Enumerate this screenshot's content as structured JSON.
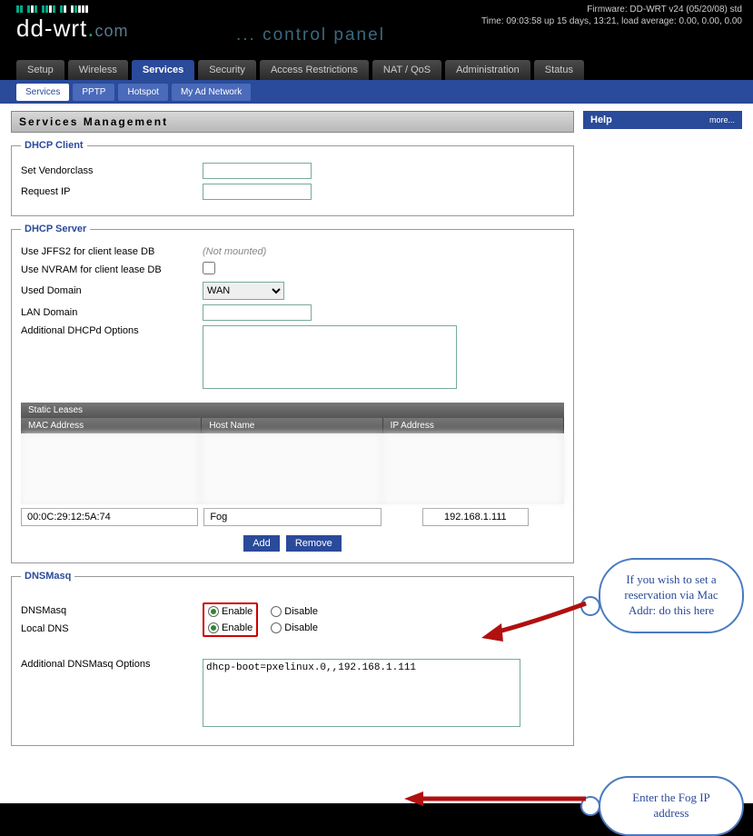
{
  "header": {
    "firmware": "Firmware: DD-WRT v24 (05/20/08) std",
    "time": "Time: 09:03:58 up 15 days, 13:21, load average: 0.00, 0.00, 0.00",
    "logo": "dd-wrt",
    "logo_dot": ".",
    "logo_com": "com",
    "cp": "... control panel"
  },
  "tabs": [
    "Setup",
    "Wireless",
    "Services",
    "Security",
    "Access Restrictions",
    "NAT / QoS",
    "Administration",
    "Status"
  ],
  "active_tab": "Services",
  "subtabs": [
    "Services",
    "PPTP",
    "Hotspot",
    "My Ad Network"
  ],
  "active_subtab": "Services",
  "title": "Services Management",
  "help": {
    "title": "Help",
    "more": "more..."
  },
  "dhcp_client": {
    "legend": "DHCP Client",
    "vendorclass_label": "Set Vendorclass",
    "vendorclass_value": "",
    "requestip_label": "Request IP",
    "requestip_value": ""
  },
  "dhcp_server": {
    "legend": "DHCP Server",
    "jffs2_label": "Use JFFS2 for client lease DB",
    "jffs2_status": "(Not mounted)",
    "nvram_label": "Use NVRAM for client lease DB",
    "used_domain_label": "Used Domain",
    "used_domain_value": "WAN",
    "lan_domain_label": "LAN Domain",
    "lan_domain_value": "",
    "dhcpd_options_label": "Additional DHCPd Options",
    "dhcpd_options_value": "",
    "static_leases": {
      "title": "Static Leases",
      "cols": [
        "MAC Address",
        "Host Name",
        "IP Address"
      ],
      "entry": {
        "mac": "00:0C:29:12:5A:74",
        "host": "Fog",
        "ip": "192.168.1.111"
      },
      "add": "Add",
      "remove": "Remove"
    }
  },
  "dnsmasq": {
    "legend": "DNSMasq",
    "dnsmasq_label": "DNSMasq",
    "localdns_label": "Local DNS",
    "enable": "Enable",
    "disable": "Disable",
    "options_label": "Additional DNSMasq Options",
    "options_value": "dhcp-boot=pxelinux.0,,192.168.1.111"
  },
  "callouts": {
    "c1": "If you wish to set a reservation via Mac Addr: do this here",
    "c2": "Enter the Fog IP address"
  }
}
